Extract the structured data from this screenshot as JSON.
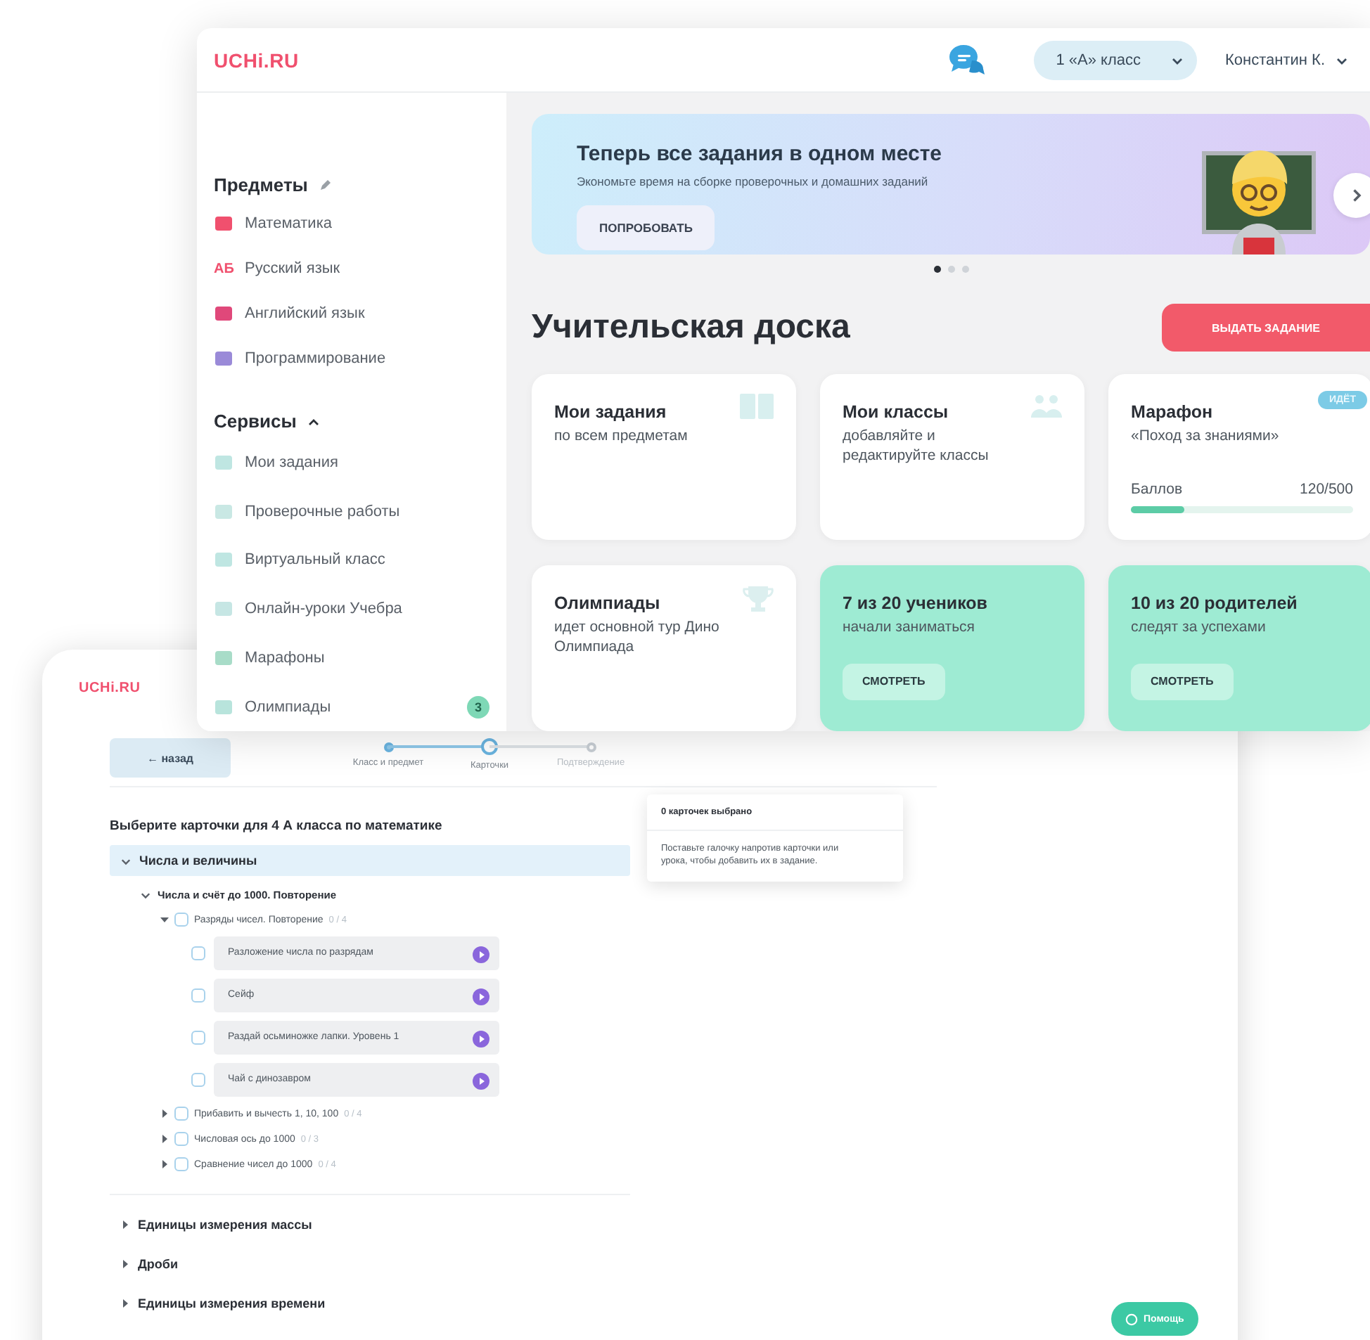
{
  "front_window": {
    "logo": "UCHi.RU",
    "back_button": "← назад",
    "steps": [
      {
        "label": "Класс и предмет",
        "completed": true,
        "selected": false
      },
      {
        "label": "Карточки",
        "completed": false,
        "selected": true
      },
      {
        "label": "Подтверждение",
        "completed": false,
        "selected": false
      }
    ],
    "heading": "Выберите карточки для 4 А класса по математике",
    "tree": [
      {
        "kind": "topic",
        "label": "Числа и величины",
        "expanded": true,
        "children": [
          {
            "kind": "subtopic",
            "label": "Числа и счёт до 1000. Повторение",
            "expanded": true,
            "children": [
              {
                "kind": "lesson",
                "label": "Разряды чисел. Повторение",
                "count": "0 / 4",
                "checked": false,
                "expanded": true,
                "children": [
                  {
                    "kind": "card",
                    "label": "Разложение числа по разрядам",
                    "checked": false
                  },
                  {
                    "kind": "card",
                    "label": "Сейф",
                    "checked": false
                  },
                  {
                    "kind": "card",
                    "label": "Раздай осьминожке лапки. Уровень 1",
                    "checked": false
                  },
                  {
                    "kind": "card",
                    "label": "Чай с динозавром",
                    "checked": false
                  }
                ]
              },
              {
                "kind": "lesson",
                "label": "Прибавить и вычесть 1, 10, 100",
                "count": "0 / 4",
                "checked": false,
                "expanded": false
              },
              {
                "kind": "lesson",
                "label": "Числовая ось до 1000",
                "count": "0 / 3",
                "checked": false,
                "expanded": false
              },
              {
                "kind": "lesson",
                "label": "Сравнение чисел до 1000",
                "count": "0 / 4",
                "checked": false,
                "expanded": false
              }
            ]
          }
        ]
      },
      {
        "kind": "topic",
        "label": "Единицы измерения массы",
        "expanded": false
      },
      {
        "kind": "topic",
        "label": "Дроби",
        "expanded": false
      },
      {
        "kind": "topic",
        "label": "Единицы измерения времени",
        "expanded": false
      }
    ],
    "selection_panel": {
      "title": "0 карточек выбрано",
      "hint": "Поставьте галочку напротив карточки или урока, чтобы добавить их в задание."
    },
    "help_button": "Помощь"
  },
  "back_window": {
    "logo": "UCHi.RU",
    "class_select": {
      "value": "1 «А» класс"
    },
    "user_menu": {
      "label": "Константин К."
    },
    "sidebar": {
      "subjects": {
        "title": "Предметы",
        "items": [
          {
            "label": "Математика",
            "color": "#f0506e"
          },
          {
            "label": "Русский язык",
            "color": "#f0506e",
            "icon_text": "АБ"
          },
          {
            "label": "Английский язык",
            "color": "#e0487a"
          },
          {
            "label": "Программирование",
            "color": "#9a8ad8"
          }
        ]
      },
      "services": {
        "title": "Сервисы",
        "expanded": true,
        "items": [
          {
            "label": "Мои задания"
          },
          {
            "label": "Проверочные работы"
          },
          {
            "label": "Виртуальный класс"
          },
          {
            "label": "Онлайн-уроки Учебра"
          },
          {
            "label": "Марафоны"
          },
          {
            "label": "Олимпиады",
            "badge": "3"
          }
        ]
      }
    },
    "banner": {
      "title": "Теперь все задания в одном месте",
      "subtitle": "Экономьте время на сборке проверочных и домашних заданий",
      "button": "ПОПРОБОВАТЬ",
      "dots": [
        {
          "selected": true
        },
        {
          "selected": false
        },
        {
          "selected": false
        }
      ]
    },
    "dashboard": {
      "title": "Учительская доска",
      "button": "ВЫДАТЬ ЗАДАНИЕ",
      "cards": [
        {
          "kind": "plain",
          "title": "Мои задания",
          "subtitle": "по всем предметам"
        },
        {
          "kind": "plain",
          "title": "Мои классы",
          "subtitle": "добавляйте и редактируйте классы"
        },
        {
          "kind": "progress",
          "title": "Марафон",
          "subtitle": "«Поход за знаниями»",
          "badge": "ИДЁТ",
          "progress_label": "Баллов",
          "progress_reading": "120/500",
          "level": 0.24
        },
        {
          "kind": "plain",
          "title": "Олимпиады",
          "subtitle": "идет основной тур Дино Олимпиада"
        },
        {
          "kind": "stat",
          "title": "7 из 20 учеников",
          "subtitle": "начали заниматься",
          "button": "СМОТРЕТЬ"
        },
        {
          "kind": "stat",
          "title": "10 из 20 родителей",
          "subtitle": "следят за успехами",
          "button": "СМОТРЕТЬ"
        }
      ]
    }
  }
}
